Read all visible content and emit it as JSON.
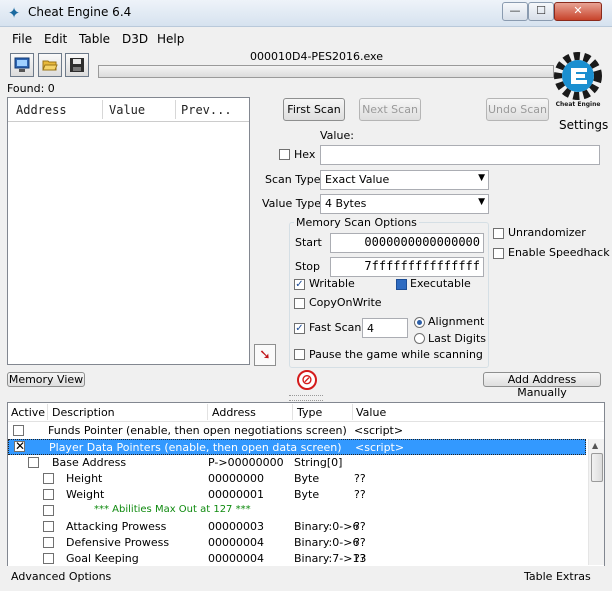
{
  "window": {
    "title": "Cheat Engine 6.4",
    "buttons": {
      "minimize": "—",
      "maximize": "☐",
      "close": "✕"
    }
  },
  "menu": [
    "File",
    "Edit",
    "Table",
    "D3D",
    "Help"
  ],
  "process_title": "000010D4-PES2016.exe",
  "found_label": "Found: 0",
  "logo_text": "Cheat Engine",
  "settings_label": "Settings",
  "results_columns": [
    "Address",
    "Value",
    "Prev..."
  ],
  "scan_buttons": {
    "first": "First Scan",
    "next": "Next Scan",
    "undo": "Undo Scan"
  },
  "value_label": "Value:",
  "hex_label": "Hex",
  "scan_type": {
    "label": "Scan Type",
    "value": "Exact Value"
  },
  "value_type": {
    "label": "Value Type",
    "value": "4 Bytes"
  },
  "memory_options": {
    "title": "Memory Scan Options",
    "start_label": "Start",
    "start_value": "0000000000000000",
    "stop_label": "Stop",
    "stop_value": "7fffffffffffffff",
    "writable": "Writable",
    "executable": "Executable",
    "copy_on_write": "CopyOnWrite",
    "fast_scan": "Fast Scan",
    "fast_scan_value": "4",
    "alignment": "Alignment",
    "last_digits": "Last Digits",
    "pause": "Pause the game while scanning"
  },
  "unrandomizer": "Unrandomizer",
  "speedhack": "Enable Speedhack",
  "memory_view_button": "Memory View",
  "add_address_button": "Add Address Manually",
  "table_columns": [
    "Active",
    "Description",
    "Address",
    "Type",
    "Value"
  ],
  "table_rows": [
    {
      "description": "Funds Pointer (enable, then open negotiations screen)",
      "address": "",
      "type": "",
      "value": "<script>"
    },
    {
      "description": "Player Data Pointers (enable, then open data screen)",
      "address": "",
      "type": "",
      "value": "<script>"
    },
    {
      "description": "Base Address",
      "address": "P->00000000",
      "type": "String[0]",
      "value": ""
    },
    {
      "description": "Height",
      "address": "00000000",
      "type": "Byte",
      "value": "??"
    },
    {
      "description": "Weight",
      "address": "00000001",
      "type": "Byte",
      "value": "??"
    },
    {
      "description": "*** Abilities Max Out at 127 ***",
      "address": "",
      "type": "",
      "value": ""
    },
    {
      "description": "Attacking Prowess",
      "address": "00000003",
      "type": "Binary:0->6",
      "value": "??"
    },
    {
      "description": "Defensive Prowess",
      "address": "00000004",
      "type": "Binary:0->6",
      "value": "??"
    },
    {
      "description": "Goal Keeping",
      "address": "00000004",
      "type": "Binary:7->13",
      "value": "??"
    }
  ],
  "status": {
    "left": "Advanced Options",
    "right": "Table Extras"
  }
}
